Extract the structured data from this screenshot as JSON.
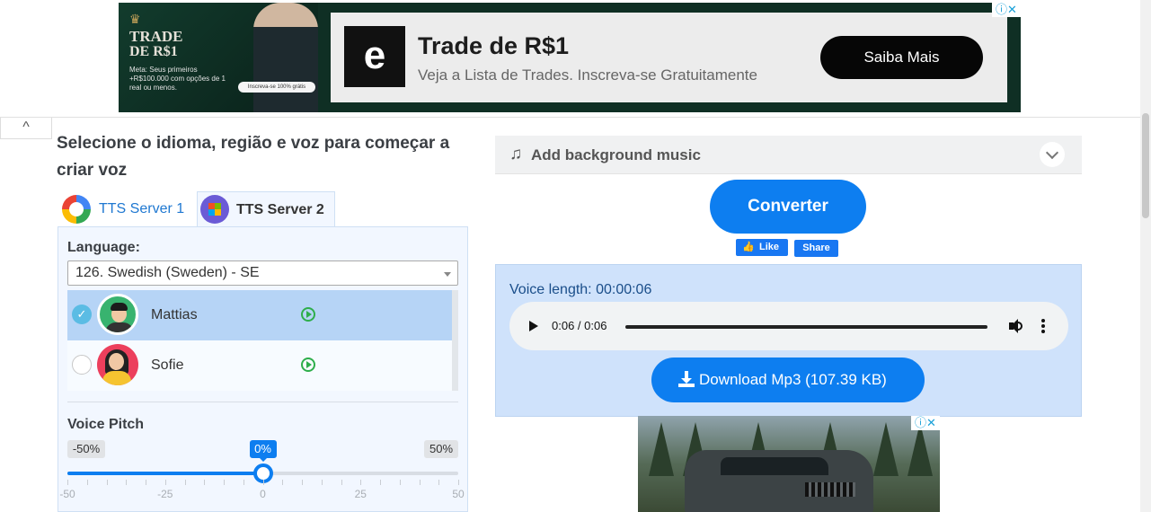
{
  "top_ad": {
    "brand_line1": "TRADE",
    "brand_line2": "DE R$1",
    "small_text": "Meta: Seus primeiros +R$100.000 com opções de 1 real ou menos.",
    "chip_text": "Inscreva-se 100% grátis",
    "logo_glyph": "e",
    "title": "Trade de R$1",
    "subtitle": "Veja a Lista de Trades. Inscreva-se Gratuitamente",
    "cta": "Saiba Mais",
    "adchoices": "ⓘ✕"
  },
  "collapse_glyph": "^",
  "heading": "Selecione o idioma, região e voz para começar a criar voz",
  "tabs": [
    {
      "label": "TTS Server 1",
      "active": false
    },
    {
      "label": "TTS Server 2",
      "active": true
    }
  ],
  "language": {
    "label": "Language:",
    "selected": "126. Swedish (Sweden) - SE"
  },
  "voices": [
    {
      "name": "Mattias",
      "selected": true,
      "check": "✓"
    },
    {
      "name": "Sofie",
      "selected": false,
      "check": ""
    }
  ],
  "pitch": {
    "label": "Voice Pitch",
    "min_label": "-50%",
    "max_label": "50%",
    "current_label": "0%",
    "value": 0,
    "min": -50,
    "max": 50,
    "ticks": [
      "-50",
      "-25",
      "0",
      "25",
      "50"
    ]
  },
  "music": {
    "icon": "♫",
    "label": "Add background music"
  },
  "convert_label": "Converter",
  "social": {
    "like_icon": "👍",
    "like_label": "Like",
    "share_label": "Share"
  },
  "result": {
    "voice_length": "Voice length: 00:00:06",
    "time": "0:06 / 0:06",
    "progress": 1.0,
    "download_label": "Download Mp3 (107.39 KB)"
  },
  "colors": {
    "accent": "#0d7ef0",
    "selected_row": "#b6d4f6",
    "result_bg": "#cfe2fb",
    "play_green": "#2eae4b"
  }
}
